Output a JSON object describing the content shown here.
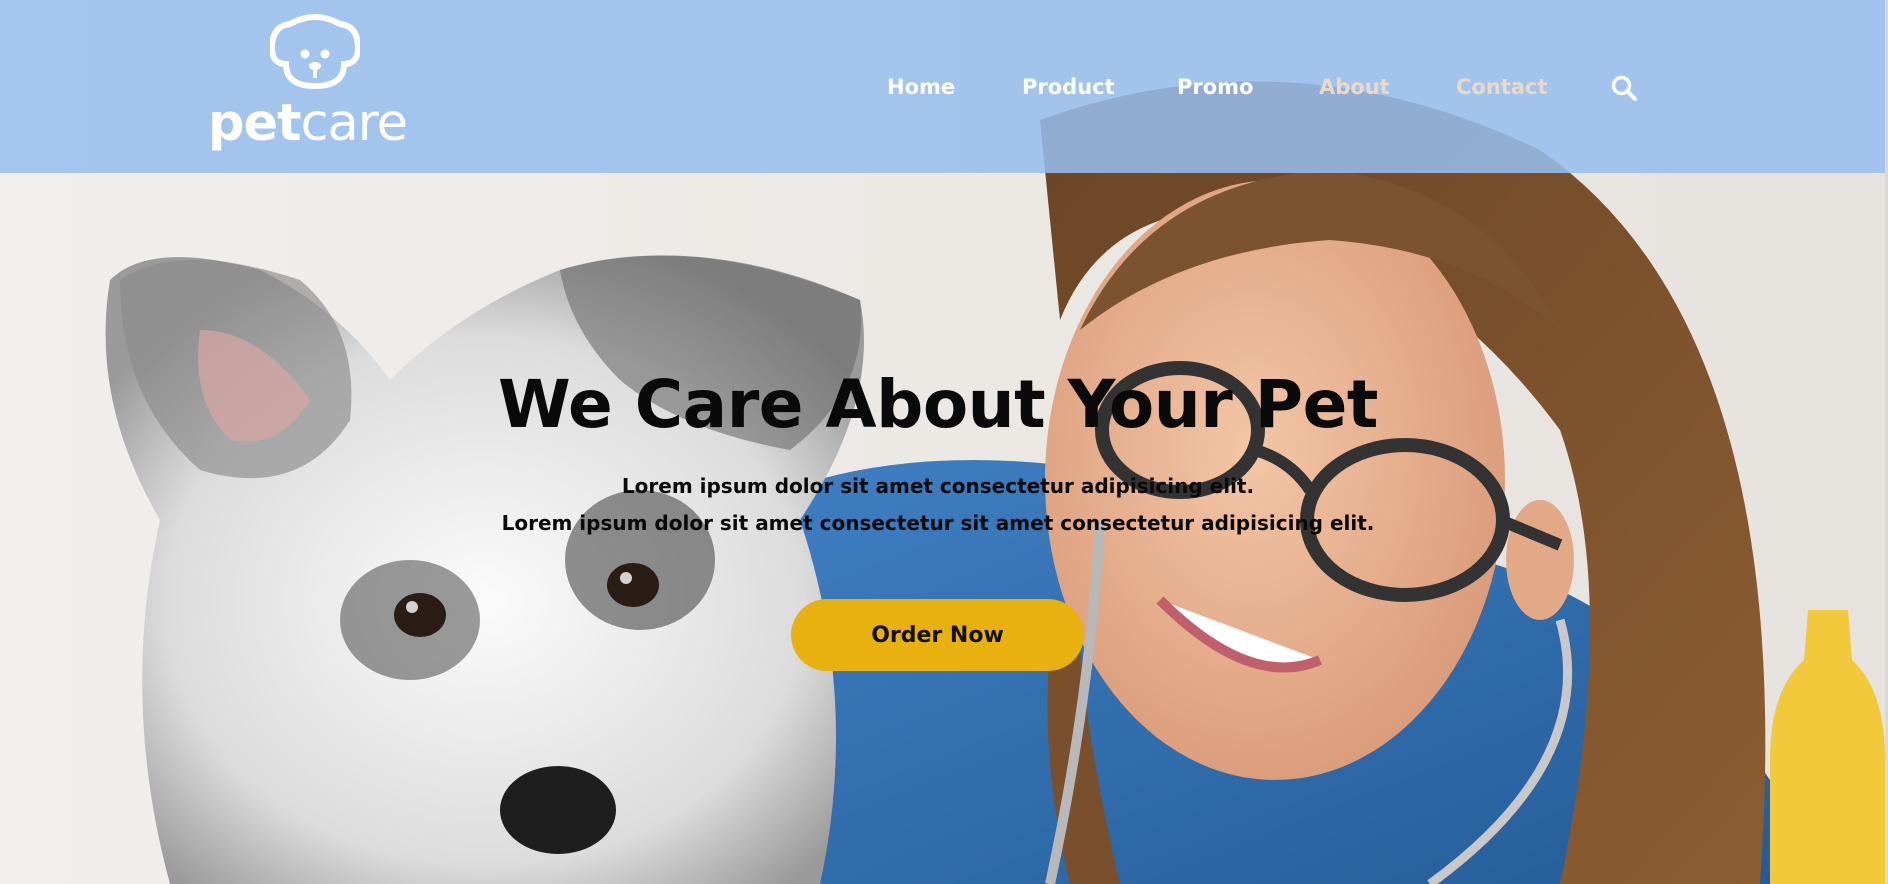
{
  "brand": {
    "name_part1": "pet",
    "name_part2": "care",
    "icon": "dog-face-icon"
  },
  "nav": {
    "items": [
      {
        "label": "Home"
      },
      {
        "label": "Product"
      },
      {
        "label": "Promo"
      },
      {
        "label": "About"
      },
      {
        "label": "Contact"
      }
    ],
    "search_icon": "search-icon"
  },
  "hero": {
    "title": "We Care About Your Pet",
    "subtitle_line1": "Lorem ipsum dolor sit amet consectetur adipisicing elit.",
    "subtitle_line2": "Lorem ipsum dolor sit amet consectetur sit amet consectetur adipisicing elit.",
    "cta_label": "Order Now"
  },
  "colors": {
    "header_bg": "#96BEEE",
    "cta_bg": "#E9B10F",
    "text_dark": "#0A0A0A",
    "nav_text": "#FFFFFF"
  }
}
